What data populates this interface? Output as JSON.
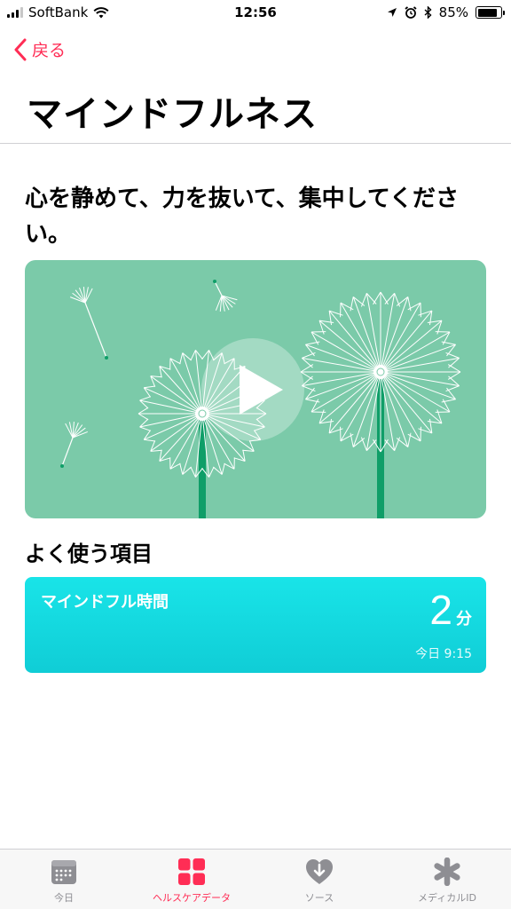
{
  "status_bar": {
    "carrier": "SoftBank",
    "time": "12:56",
    "battery_percent": "85%",
    "battery_level": 0.85,
    "icons": [
      "signal-icon",
      "wifi-icon",
      "location-icon",
      "alarm-icon",
      "bluetooth-icon",
      "battery-icon"
    ]
  },
  "nav": {
    "back_label": "戻る",
    "title": "マインドフルネス"
  },
  "hero": {
    "tagline": "心を静めて、力を抜いて、集中してください。",
    "video": {
      "play_icon": "play-icon",
      "illustration": "dandelion-illustration"
    }
  },
  "favorites": {
    "title": "よく使う項目",
    "items": [
      {
        "label": "マインドフル時間",
        "value": "2",
        "unit": "分",
        "timestamp": "今日 9:15"
      }
    ]
  },
  "tab_bar": {
    "tabs": [
      {
        "label": "今日",
        "icon": "calendar-icon",
        "active": false
      },
      {
        "label": "ヘルスケアデータ",
        "icon": "grid-icon",
        "active": true
      },
      {
        "label": "ソース",
        "icon": "heart-download-icon",
        "active": false
      },
      {
        "label": "メディカルID",
        "icon": "asterisk-icon",
        "active": false
      }
    ]
  },
  "colors": {
    "accent": "#ff2d55",
    "card_green": "#7bcaa9",
    "stem_green": "#0f9e68",
    "mindful_teal": "#19e4e8",
    "tab_inactive": "#8e8e93"
  }
}
